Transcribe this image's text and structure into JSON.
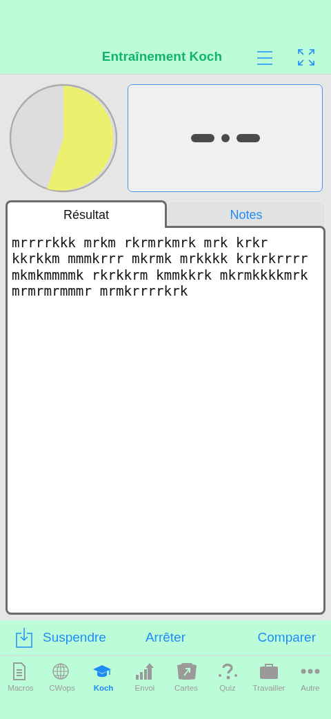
{
  "header": {
    "title": "Entraînement Koch"
  },
  "morse": [
    {
      "kind": "dash"
    },
    {
      "kind": "dot"
    },
    {
      "kind": "dash"
    }
  ],
  "tabs": [
    {
      "label": "Résultat",
      "selected": true
    },
    {
      "label": "Notes",
      "selected": false
    }
  ],
  "result_text": "mrrrrkkk mrkm rkrmrkmrk mrk krkr kkrkkm mmmkrrr mkrmk mrkkkk krkrkrrrr mkmkmmmmk rkrkkrm kmmkkrk mkrmkkkkmrk mrmrmrmmmr mrmkrrrrkrk",
  "toolbar": [
    {
      "label": "Suspendre",
      "kind": "icon"
    },
    {
      "label": "Arrêter",
      "kind": "plain"
    },
    {
      "label": "Comparer",
      "kind": "plain"
    }
  ],
  "tab_bar": [
    {
      "label": "Macros",
      "selected": false
    },
    {
      "label": "CWops",
      "selected": false
    },
    {
      "label": "Koch",
      "selected": true
    },
    {
      "label": "Envoi",
      "selected": false
    },
    {
      "label": "Cartes",
      "selected": false
    },
    {
      "label": "Quiz",
      "selected": false
    },
    {
      "label": "Travailler",
      "selected": false
    },
    {
      "label": "Autre",
      "selected": false
    }
  ]
}
